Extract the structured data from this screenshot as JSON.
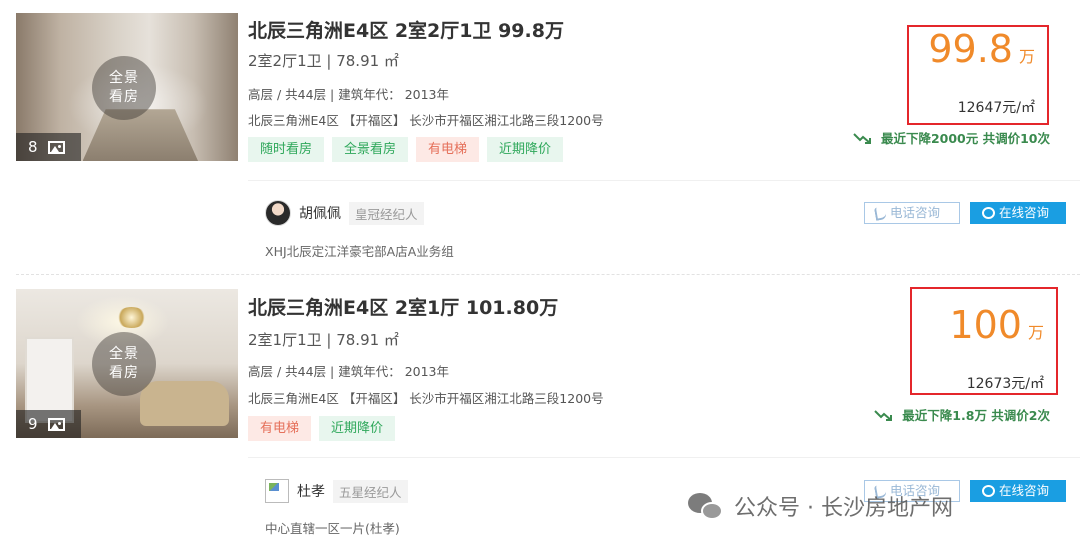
{
  "listings": [
    {
      "title": "北辰三角洲E4区 2室2厅1卫 99.8万",
      "layout": "2室2厅1卫 | 78.91 ㎡",
      "floor_info": "高层 / 共44层 | 建筑年代： 2013年",
      "address": "北辰三角洲E4区 【开福区】 长沙市开福区湘江北路三段1200号",
      "photo": {
        "pano_label": "全景看房",
        "count": "8"
      },
      "tags": [
        {
          "label": "随时看房",
          "color": "green"
        },
        {
          "label": "全景看房",
          "color": "green"
        },
        {
          "label": "有电梯",
          "color": "red"
        },
        {
          "label": "近期降价",
          "color": "green"
        }
      ],
      "price": {
        "value": "99.8",
        "unit": "万",
        "unit_price": "12647元/㎡"
      },
      "price_drop": "最近下降2000元  共调价10次",
      "agent": {
        "name": "胡佩佩",
        "level": "皇冠经纪人",
        "shop": "XHJ北辰定江洋豪宅部A店A业务组"
      },
      "buttons": {
        "call": "电话咨询",
        "chat": "在线咨询"
      }
    },
    {
      "title": "北辰三角洲E4区 2室1厅 101.80万",
      "layout": "2室1厅1卫 | 78.91 ㎡",
      "floor_info": "高层 / 共44层 | 建筑年代： 2013年",
      "address": "北辰三角洲E4区 【开福区】 长沙市开福区湘江北路三段1200号",
      "photo": {
        "pano_label": "全景看房",
        "count": "9"
      },
      "tags": [
        {
          "label": "有电梯",
          "color": "red"
        },
        {
          "label": "近期降价",
          "color": "green"
        }
      ],
      "price": {
        "value": "100",
        "unit": "万",
        "unit_price": "12673元/㎡"
      },
      "price_drop": "最近下降1.8万  共调价2次",
      "agent": {
        "name": "杜孝",
        "level": "五星经纪人",
        "shop": "中心直辖一区一片(杜孝)"
      },
      "buttons": {
        "call": "电话咨询",
        "chat": "在线咨询"
      }
    }
  ],
  "watermark": {
    "text": "公众号 · 长沙房地产网"
  },
  "colors": {
    "price": "#f08a2a",
    "highlight_box": "#e4262b",
    "chat_button": "#1a9ee2",
    "tag_green": "#2fa85b",
    "tag_red": "#e5705a"
  }
}
